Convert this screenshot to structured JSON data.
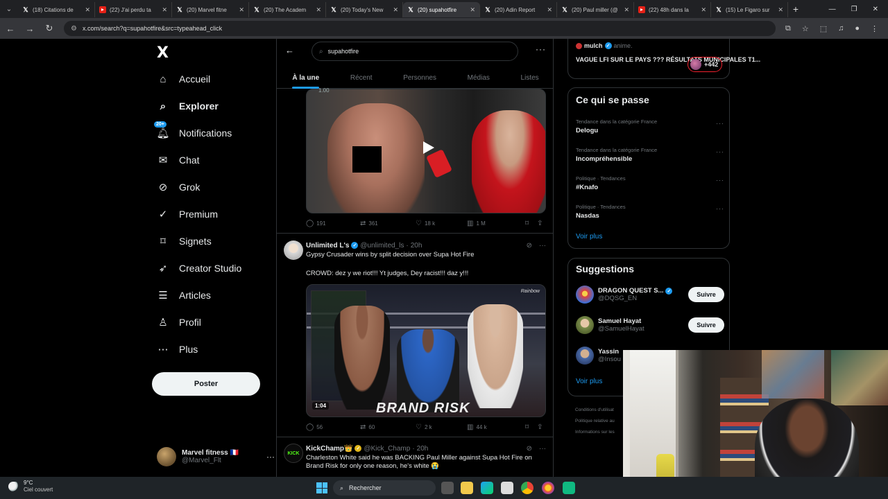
{
  "browser": {
    "tabs": [
      {
        "title": "(18) Citations de",
        "icon": "x-icon",
        "active": false
      },
      {
        "title": "(22) J'ai perdu ta",
        "icon": "youtube-icon",
        "active": false
      },
      {
        "title": "(20) Marvel fitne",
        "icon": "x-icon",
        "active": false
      },
      {
        "title": "(20) The Academ",
        "icon": "x-icon",
        "active": false
      },
      {
        "title": "(20) Today's New",
        "icon": "x-icon",
        "active": false
      },
      {
        "title": "(20) supahotfire",
        "icon": "x-icon",
        "active": true
      },
      {
        "title": "(20) Adin Report",
        "icon": "x-icon",
        "active": false
      },
      {
        "title": "(20) Paul miller (@",
        "icon": "x-icon",
        "active": false
      },
      {
        "title": "(22) 48h dans la",
        "icon": "youtube-icon",
        "active": false
      },
      {
        "title": "(15) Le Figaro sur",
        "icon": "x-icon",
        "active": false
      }
    ],
    "url": "x.com/search?q=supahotfire&src=typeahead_click"
  },
  "sidebar": {
    "logo": "X",
    "items": [
      {
        "label": "Accueil",
        "icon": "home-icon"
      },
      {
        "label": "Explorer",
        "icon": "search-icon",
        "bold": true
      },
      {
        "label": "Notifications",
        "icon": "bell-icon",
        "badge": "20+"
      },
      {
        "label": "Chat",
        "icon": "mail-icon"
      },
      {
        "label": "Grok",
        "icon": "grok-icon"
      },
      {
        "label": "Premium",
        "icon": "verified-icon"
      },
      {
        "label": "Signets",
        "icon": "bookmark-icon"
      },
      {
        "label": "Creator Studio",
        "icon": "rocket-icon"
      },
      {
        "label": "Articles",
        "icon": "article-icon"
      },
      {
        "label": "Profil",
        "icon": "user-icon"
      },
      {
        "label": "Plus",
        "icon": "more-circle-icon"
      }
    ],
    "post_label": "Poster",
    "account": {
      "name": "Marvel fitness 🇫🇷",
      "handle": "@Marvel_Flt"
    }
  },
  "search": {
    "query": "supahotfire",
    "tabs": [
      "À la une",
      "Récent",
      "Personnes",
      "Médias",
      "Listes"
    ]
  },
  "tweets": [
    {
      "media_top_label": "1.00",
      "replies": "191",
      "reposts": "361",
      "likes": "18 k",
      "views": "1 M"
    },
    {
      "name": "Unlimited L's",
      "handle": "@unlimited_ls",
      "time": "20h",
      "text1": "Gypsy Crusader wins by split decision over Supa Hot Fire",
      "text2": "CROWD: dez y we riot!!! Yt judges, Dey racist!!! daz y!!!",
      "video_duration": "1:04",
      "video_caption": "BRAND RISK",
      "watermark": "Rainbow",
      "replies": "56",
      "reposts": "60",
      "likes": "2 k",
      "views": "44 k"
    },
    {
      "name": "KickChamp👑",
      "handle": "@Kick_Champ",
      "time": "20h",
      "text1": "Charleston White said he was BACKING Paul Miller against Supa Hot Fire on Brand Risk for only one reason, he's white 😭",
      "avatar_text": "KICK"
    }
  ],
  "right": {
    "promo": {
      "name": "mulch",
      "meta": "anime.",
      "text": "VAGUE LFI SUR LE PAYS ??? RÉSULTATS MUNICIPALES T1...",
      "count": "+442"
    },
    "trends_title": "Ce qui se passe",
    "trends": [
      {
        "category": "Tendance dans la catégorie France",
        "name": "Delogu"
      },
      {
        "category": "Tendance dans la catégorie France",
        "name": "Incompréhensible"
      },
      {
        "category": "Politique · Tendances",
        "name": "#Knafo"
      },
      {
        "category": "Politique · Tendances",
        "name": "Nasdas"
      }
    ],
    "show_more": "Voir plus",
    "suggestions_title": "Suggestions",
    "suggestions": [
      {
        "name": "DRAGON QUEST S...",
        "handle": "@DQSG_EN",
        "verified": true,
        "follow": "Suivre"
      },
      {
        "name": "Samuel Hayat",
        "handle": "@SamuelHayat",
        "verified": false,
        "follow": "Suivre"
      },
      {
        "name": "Yassin",
        "handle": "@Insou",
        "verified": false,
        "follow": ""
      }
    ],
    "footer": [
      "Conditions d'utilisat",
      "Politique relative au",
      "Informations sur les"
    ]
  },
  "taskbar": {
    "temp": "9°C",
    "weather": "Ciel couvert",
    "search": "Rechercher"
  },
  "colors": {
    "accent": "#1d9bf0",
    "background": "#000000",
    "muted": "#71767b"
  }
}
